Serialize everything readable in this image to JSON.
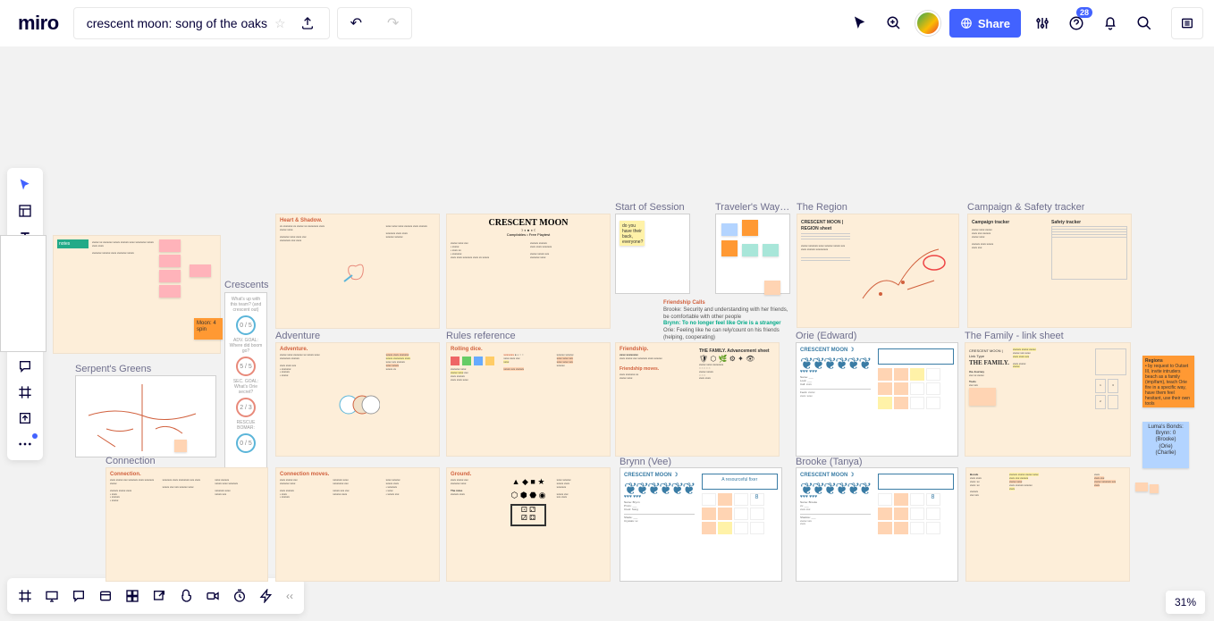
{
  "app": {
    "logo": "miro",
    "title": "crescent moon: song of the oaks"
  },
  "topbar": {
    "share": "Share",
    "notif_badge": "28"
  },
  "zoom": "31%",
  "frames": {
    "crescents": "Crescents",
    "adventure": "Adventure",
    "serpents": "Serpent's Greens",
    "connection": "Connection",
    "rules": "Rules reference",
    "start": "Start of Session",
    "travelers": "Traveler's Wayp…",
    "region": "The Region",
    "tracker": "Campaign & Safety tracker",
    "orie": "Orie (Edward)",
    "family": "The Family - link sheet",
    "brynn": "Brynn (Vee)",
    "brooke": "Brooke (Tanya)"
  },
  "headings": {
    "heart": "Heart & Shadow.",
    "adventure": "Adventure.",
    "connection": "Connection.",
    "connection_moves": "Connection moves.",
    "ground": "Ground.",
    "rolling": "Rolling dice.",
    "friendship": "Friendship.",
    "crescent_logo": "CRESCENT MOON",
    "crescent_sub": "Campfables • Free Playtest",
    "char_title": "CRESCENT MOON ☽",
    "fam_title": "THE FAMILY. Advancement sheet",
    "fam_title2": "THE FAMILY.",
    "box1": "A resourceful fixer"
  },
  "crescents": {
    "row1": "What's up with this team? (and crescent out)",
    "v1": "0 / 5",
    "row2": "ADV. GOAL: Where did boom go?",
    "v2": "5 / 5",
    "row3": "SEC. GOAL: What's Orie secret?",
    "v3": "2 / 3",
    "row4": "RESCUE BOMAR:",
    "v4": "0 / 5"
  },
  "stickies": {
    "moon": "Moon: 4 spin",
    "start": "do you have their back, everyone?",
    "bonds_title": "Luma's Bonds:",
    "bonds_a": "Brynn: 0",
    "bonds_b": "(Brooke)",
    "bonds_c": "(Orie)",
    "bonds_d": "(Charlie)",
    "region_t": "Regions"
  },
  "floating": {
    "fc_title": "Friendship Calls",
    "fc_1": "Brooke: Security and understanding with her friends, be comfortable with other people",
    "fc_2": "Brynn: To no longer feel like Orie is a stranger",
    "fc_3": "Orie: Feeling like he can rely/count on his friends (helping, cooperating)"
  }
}
